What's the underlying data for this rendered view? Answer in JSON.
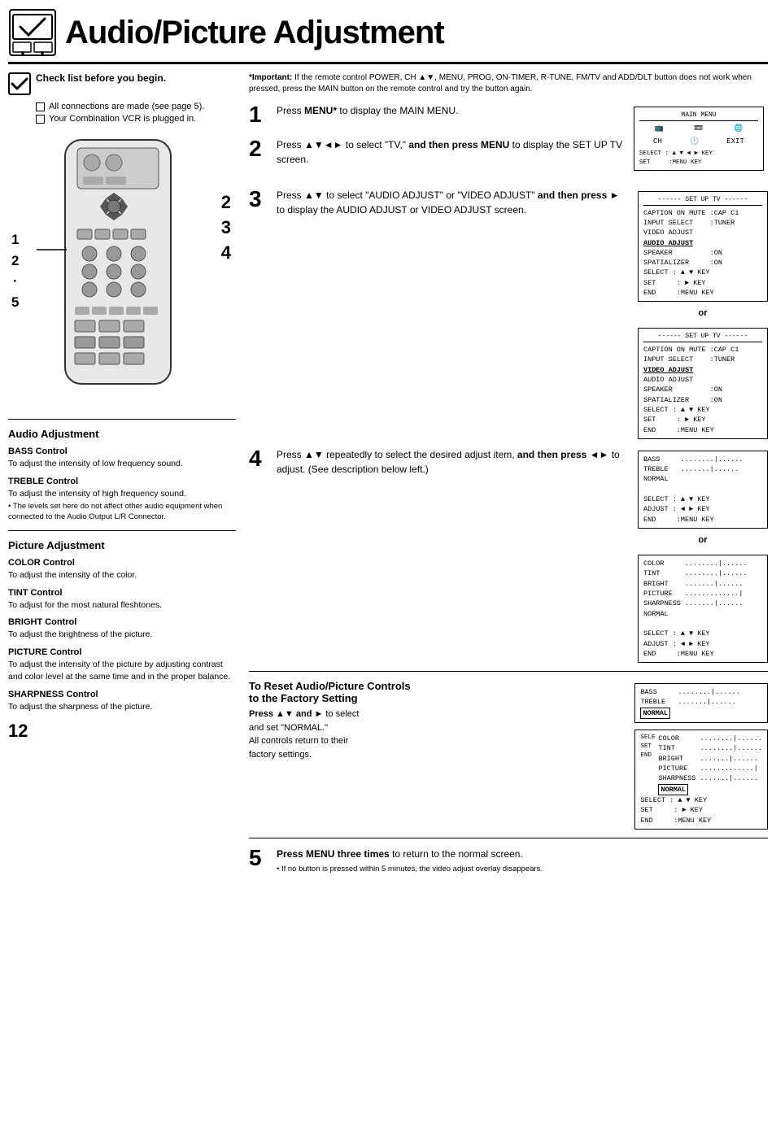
{
  "header": {
    "title": "Audio/Picture Adjustment"
  },
  "checklist": {
    "title": "Check list before you begin.",
    "items": [
      "All connections are made (see page 5).",
      "Your Combination VCR is plugged in."
    ]
  },
  "important_note": {
    "label": "*Important:",
    "text": "If the remote control POWER, CH ▲▼, MENU, PROG, ON-TIMER, R-TUNE, FM/TV and ADD/DLT button does not work when pressed, press the MAIN button on the remote control and try the button again."
  },
  "steps": [
    {
      "number": "1",
      "text": "Press MENU* to display the MAIN MENU."
    },
    {
      "number": "2",
      "text": "Press ▲▼◄► to select \"TV,\" and then press MENU to display the SET UP TV screen."
    },
    {
      "number": "3",
      "text": "Press ▲▼ to select \"AUDIO ADJUST\" or \"VIDEO ADJUST\" and then press ► to display the AUDIO ADJUST or VIDEO ADJUST screen."
    },
    {
      "number": "4",
      "text": "Press ▲▼ repeatedly to select the desired adjust item, and then press ◄► to adjust. (See description below left.)"
    },
    {
      "number": "5",
      "text": "Press MENU three times to return to the normal screen.",
      "note": "• If no button is pressed within 5 minutes, the video adjust overlay disappears."
    }
  ],
  "audio_adjustment": {
    "title": "Audio Adjustment",
    "controls": [
      {
        "name": "BASS Control",
        "description": "To adjust the intensity of low frequency sound."
      },
      {
        "name": "TREBLE Control",
        "description": "To adjust the intensity of high frequency sound.",
        "note": "• The levels set here do not affect other audio equipment when connected to the Audio Output L/R Connector."
      }
    ]
  },
  "picture_adjustment": {
    "title": "Picture Adjustment",
    "controls": [
      {
        "name": "COLOR Control",
        "description": "To adjust the intensity of the color."
      },
      {
        "name": "TINT Control",
        "description": "To adjust for the most natural fleshtones."
      },
      {
        "name": "BRIGHT Control",
        "description": "To adjust the brightness of the picture."
      },
      {
        "name": "PICTURE Control",
        "description": "To adjust the intensity of the picture by adjusting contrast and color level at the same time and in the proper balance."
      },
      {
        "name": "SHARPNESS Control",
        "description": "To adjust the sharpness of the picture."
      }
    ]
  },
  "reset_section": {
    "title": "To Reset Audio/Picture Controls to the Factory Setting",
    "text": "Press ▲▼ and ► to select and set \"NORMAL.\"\nAll controls return to their factory settings."
  },
  "remote_labels": {
    "left": "1\n2\n5",
    "right": "2\n3\n4"
  },
  "page_number": "12",
  "menus": {
    "main_menu_title": "MAIN MENU",
    "main_menu_icons": [
      "TV",
      "VCR",
      "LANGUAGE",
      "CH",
      "CLOCK",
      "EXIT"
    ],
    "main_menu_select": "SELECT : ▲ ▼ ◄ ► KEY",
    "main_menu_set": "SET     : MENU KEY",
    "setup_tv_1": {
      "title": "------ SET UP TV ------",
      "lines": [
        "CAPTION ON MUTE :CAP C1",
        "INPUT SELECT    :TUNER",
        "VIDEO ADJUST",
        "AUDIO ADJUST",
        "SPEAKER         :ON",
        "SPATIALIZER     :ON",
        "SELECT : ▲ ▼ KEY",
        "SET    : ► KEY",
        "END    : MENU KEY"
      ],
      "highlighted": "AUDIO ADJUST"
    },
    "setup_tv_2": {
      "title": "------ SET UP TV ------",
      "lines": [
        "CAPTION ON MUTE :CAP C1",
        "INPUT SELECT    :TUNER",
        "VIDEO ADJUST",
        "AUDIO ADJUST",
        "SPEAKER         :ON",
        "SPATIALIZER     :ON",
        "SELECT : ▲ ▼ KEY",
        "SET    : ► KEY",
        "END    : MENU KEY"
      ],
      "highlighted": "VIDEO ADJUST"
    },
    "audio_adjust": {
      "lines": [
        "BASS     ........|......",
        "TREBLE   .......|......",
        "NORMAL"
      ],
      "footer": [
        "SELECT : ▲ ▼ KEY",
        "ADJUST : ◄ ► KEY",
        "END    : MENU KEY"
      ]
    },
    "video_adjust": {
      "lines": [
        "COLOR    ........|......",
        "TINT     ........|......",
        "BRIGHT   .......|......",
        "PICTURE  .............|",
        "SHARPNESS .......|......",
        "NORMAL"
      ],
      "footer": [
        "SELECT : ▲ ▼ KEY",
        "ADJUST : ◄ ► KEY",
        "END    : MENU KEY"
      ]
    },
    "reset_audio": {
      "lines": [
        "BASS     ........|......",
        "TREBLE   .......|......",
        "NORMAL (boxed)"
      ],
      "footer": []
    },
    "reset_video": {
      "lines": [
        "COLOR    ........|......",
        "TINT     ........|......",
        "BRIGHT   .......|......",
        "PICTURE  .............|",
        "SHARPNESS .......|......",
        "NORMAL (boxed)"
      ],
      "footer": [
        "SELECT : ▲ ▼ KEY",
        "SET    : ► KEY",
        "END    : MENU KEY"
      ]
    }
  }
}
